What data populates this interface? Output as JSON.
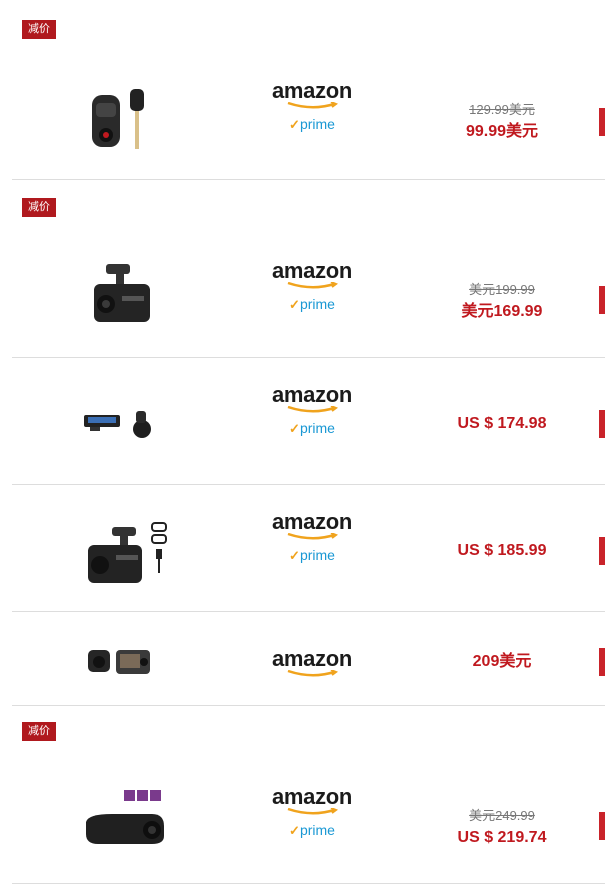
{
  "colors": {
    "accent": "#c0191f",
    "badge": "#b0191e",
    "prime": "#1a98d4",
    "check": "#f0a31d"
  },
  "offers": [
    {
      "badge": "减价",
      "store": "amazon",
      "prime": "prime",
      "old_price": "129.99美元",
      "price": "99.99美元",
      "icon": "dashcam-with-key-image"
    },
    {
      "badge": "减价",
      "store": "amazon",
      "prime": "prime",
      "old_price": "美元199.99",
      "price": "美元169.99",
      "icon": "dual-dashcam-image"
    },
    {
      "badge": "",
      "store": "amazon",
      "prime": "prime",
      "old_price": "",
      "price": "US $ 174.98",
      "icon": "mirror-dashcam-image"
    },
    {
      "badge": "",
      "store": "amazon",
      "prime": "prime",
      "old_price": "",
      "price": "US $ 185.99",
      "icon": "dashcam-kit-image"
    },
    {
      "badge": "",
      "store": "amazon",
      "prime": "",
      "old_price": "",
      "price": "209美元",
      "icon": "front-rear-dashcam-image"
    },
    {
      "badge": "减价",
      "store": "amazon",
      "prime": "prime",
      "old_price": "美元249.99",
      "price": "US $ 219.74",
      "icon": "wifi-dashcam-image"
    }
  ]
}
